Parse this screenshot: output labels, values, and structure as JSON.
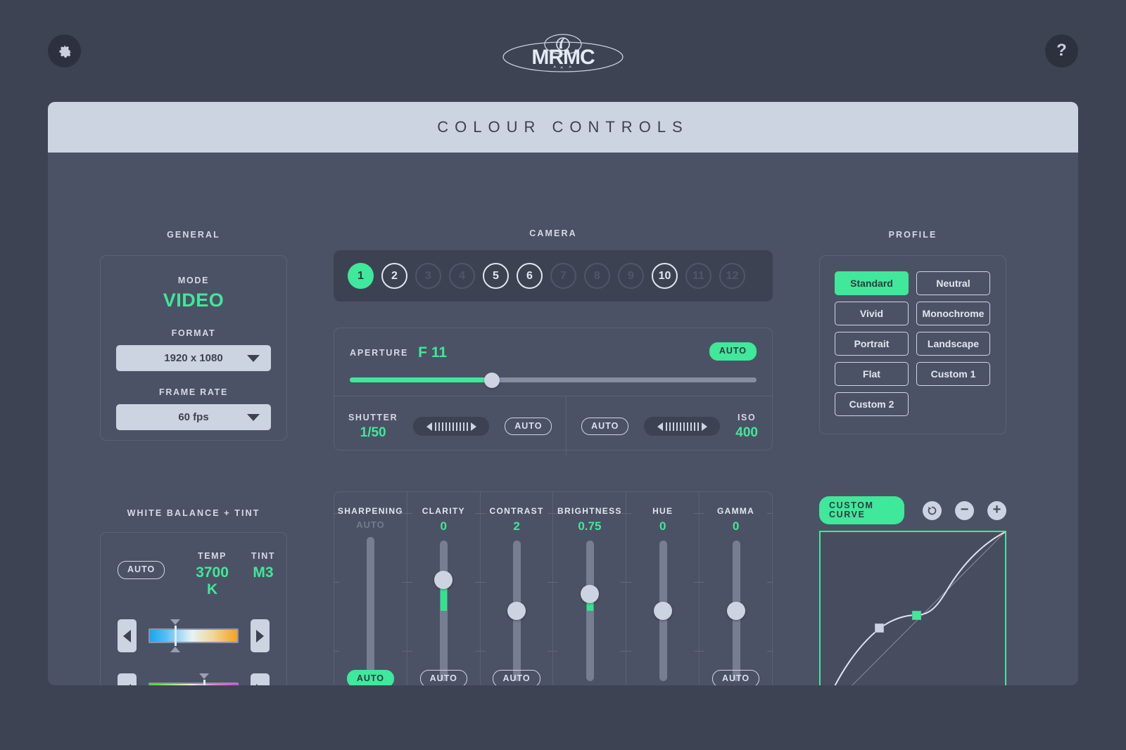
{
  "topbar": {
    "gear_icon": "gear-icon",
    "help_label": "?",
    "logo_text": "MRMC"
  },
  "header": {
    "title": "COLOUR CONTROLS"
  },
  "general": {
    "section_label": "GENERAL",
    "mode_label": "MODE",
    "mode_value": "VIDEO",
    "format_label": "FORMAT",
    "format_value": "1920 x 1080",
    "frame_rate_label": "FRAME RATE",
    "frame_rate_value": "60 fps"
  },
  "white_balance": {
    "section_label": "WHITE BALANCE + TINT",
    "auto_label": "AUTO",
    "auto_active": false,
    "temp_label": "TEMP",
    "temp_value": "3700 K",
    "tint_label": "TINT",
    "tint_value": "M3",
    "temp_marker_pct": 30,
    "tint_marker_pct": 62
  },
  "camera": {
    "section_label": "CAMERA",
    "items": [
      {
        "n": "1",
        "state": "sel"
      },
      {
        "n": "2",
        "state": "on"
      },
      {
        "n": "3",
        "state": "off"
      },
      {
        "n": "4",
        "state": "off"
      },
      {
        "n": "5",
        "state": "on"
      },
      {
        "n": "6",
        "state": "on"
      },
      {
        "n": "7",
        "state": "off"
      },
      {
        "n": "8",
        "state": "off"
      },
      {
        "n": "9",
        "state": "off"
      },
      {
        "n": "10",
        "state": "on"
      },
      {
        "n": "11",
        "state": "off"
      },
      {
        "n": "12",
        "state": "off"
      }
    ]
  },
  "exposure": {
    "aperture_label": "APERTURE",
    "aperture_value": "F 11",
    "aperture_auto_label": "AUTO",
    "aperture_auto_active": true,
    "aperture_pct": 35,
    "shutter_label": "SHUTTER",
    "shutter_value": "1/50",
    "shutter_auto_label": "AUTO",
    "shutter_auto_active": false,
    "iso_label": "ISO",
    "iso_value": "400",
    "iso_auto_label": "AUTO",
    "iso_auto_active": false
  },
  "sliders": [
    {
      "label": "SHARPENING",
      "value": "AUTO",
      "value_is_auto": true,
      "knob_pct": null,
      "auto_label": "AUTO",
      "auto_active": true
    },
    {
      "label": "CLARITY",
      "value": "0",
      "value_is_auto": false,
      "knob_pct": 28,
      "auto_label": "AUTO",
      "auto_active": false
    },
    {
      "label": "CONTRAST",
      "value": "2",
      "value_is_auto": false,
      "knob_pct": 50,
      "auto_label": "AUTO",
      "auto_active": false
    },
    {
      "label": "BRIGHTNESS",
      "value": "0.75",
      "value_is_auto": false,
      "knob_pct": 38,
      "auto_label": "AUTO",
      "auto_active": false,
      "no_auto": true
    },
    {
      "label": "HUE",
      "value": "0",
      "value_is_auto": false,
      "knob_pct": 50,
      "no_auto": true
    },
    {
      "label": "GAMMA",
      "value": "0",
      "value_is_auto": false,
      "knob_pct": 50,
      "auto_label": "AUTO",
      "auto_active": false
    }
  ],
  "profile": {
    "section_label": "PROFILE",
    "items": [
      {
        "label": "Standard",
        "active": true
      },
      {
        "label": "Neutral",
        "active": false
      },
      {
        "label": "Vivid",
        "active": false
      },
      {
        "label": "Monochrome",
        "active": false
      },
      {
        "label": "Portrait",
        "active": false
      },
      {
        "label": "Landscape",
        "active": false
      },
      {
        "label": "Flat",
        "active": false
      },
      {
        "label": "Custom 1",
        "active": false
      },
      {
        "label": "Custom 2",
        "active": false
      }
    ]
  },
  "curve": {
    "pill_label": "CUSTOM CURVE",
    "reset_icon": "reset-icon",
    "minus_label": "−",
    "plus_label": "+",
    "points": [
      {
        "x_pct": 32,
        "y_pct": 52,
        "selected": false
      },
      {
        "x_pct": 52,
        "y_pct": 45,
        "selected": true
      }
    ]
  },
  "colors": {
    "accent": "#3fe89a",
    "background": "#3e4354",
    "card": "#4c5265",
    "panel_dark": "#3d4253",
    "light": "#ccd3e1"
  }
}
